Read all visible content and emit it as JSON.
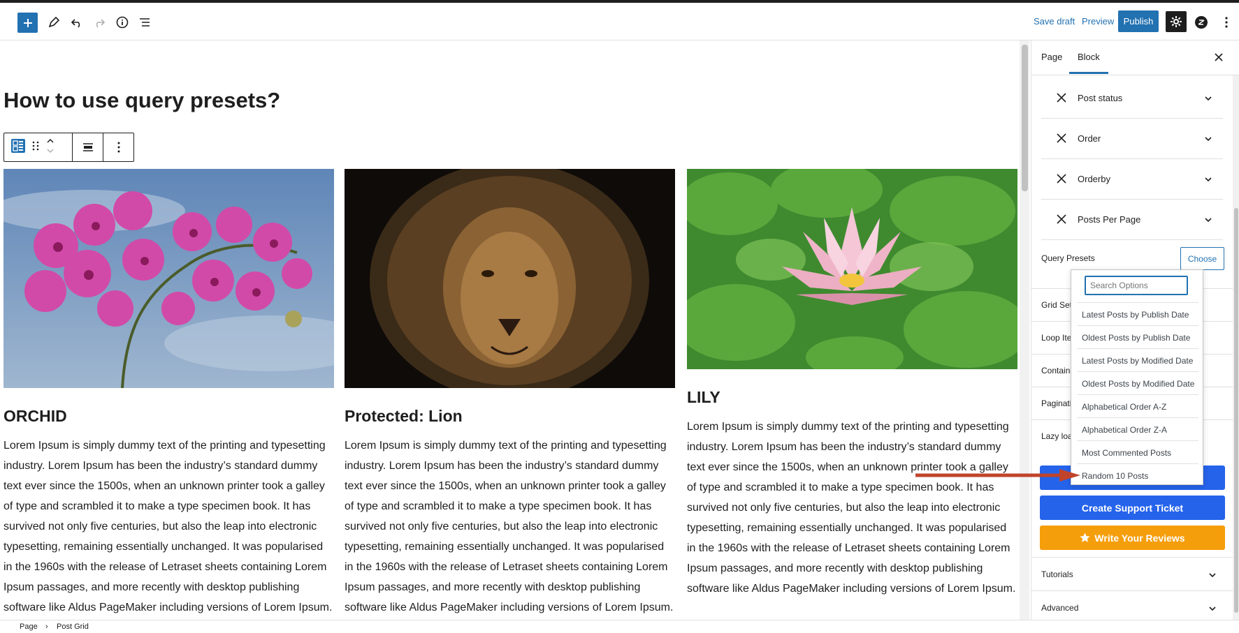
{
  "toolbar": {
    "save_draft": "Save draft",
    "preview": "Preview",
    "publish": "Publish"
  },
  "canvas": {
    "page_title": "How to use query presets?",
    "posts": [
      {
        "title": "ORCHID",
        "text": "Lorem Ipsum is simply dummy text of the printing and typesetting industry. Lorem Ipsum has been the industry’s standard dummy text ever since the 1500s, when an unknown printer took a galley of type and scrambled it to make a type specimen book. It has survived not only five centuries, but also the leap into electronic typesetting, remaining essentially unchanged. It was popularised in the 1960s with the release of Letraset sheets containing Lorem Ipsum passages, and more recently with desktop publishing software like Aldus PageMaker including versions of Lorem Ipsum."
      },
      {
        "title": "Protected: Lion",
        "text": "Lorem Ipsum is simply dummy text of the printing and typesetting industry. Lorem Ipsum has been the industry’s standard dummy text ever since the 1500s, when an unknown printer took a galley of type and scrambled it to make a type specimen book. It has survived not only five centuries, but also the leap into electronic typesetting, remaining essentially unchanged. It was popularised in the 1960s with the release of Letraset sheets containing Lorem Ipsum passages, and more recently with desktop publishing software like Aldus PageMaker including versions of Lorem Ipsum."
      },
      {
        "title": "LILY",
        "text": "Lorem Ipsum is simply dummy text of the printing and typesetting industry. Lorem Ipsum has been the industry’s standard dummy text ever since the 1500s, when an unknown printer took a galley of type and scrambled it to make a type specimen book. It has survived not only five centuries, but also the leap into electronic typesetting, remaining essentially unchanged. It was popularised in the 1960s with the release of Letraset sheets containing Lorem Ipsum passages, and more recently with desktop publishing software like Aldus PageMaker including versions of Lorem Ipsum."
      }
    ]
  },
  "sidebar": {
    "tabs": [
      "Page",
      "Block"
    ],
    "query_rows": [
      "Post status",
      "Order",
      "Orderby",
      "Posts Per Page"
    ],
    "query_presets_label": "Query Presets",
    "choose_label": "Choose",
    "partial_rows": [
      "Grid Settings",
      "Loop Item",
      "Container",
      "Pagination",
      "Lazy load"
    ],
    "support_button": "Create Support Ticket",
    "review_button": "Write Your Reviews",
    "accordions": [
      "Tutorials",
      "Advanced"
    ]
  },
  "dropdown": {
    "search_placeholder": "Search Options",
    "options": [
      "Latest Posts by Publish Date",
      "Oldest Posts by Publish Date",
      "Latest Posts by Modified Date",
      "Oldest Posts by Modified Date",
      "Alphabetical Order A-Z",
      "Alphabetical Order Z-A",
      "Most Commented Posts",
      "Random 10 Posts"
    ]
  },
  "breadcrumb": [
    "Page",
    "Post Grid"
  ],
  "colors": {
    "accent": "#2271b1",
    "support": "#2563eb",
    "review": "#f59e0b",
    "annotation_arrow": "#c0442b"
  }
}
